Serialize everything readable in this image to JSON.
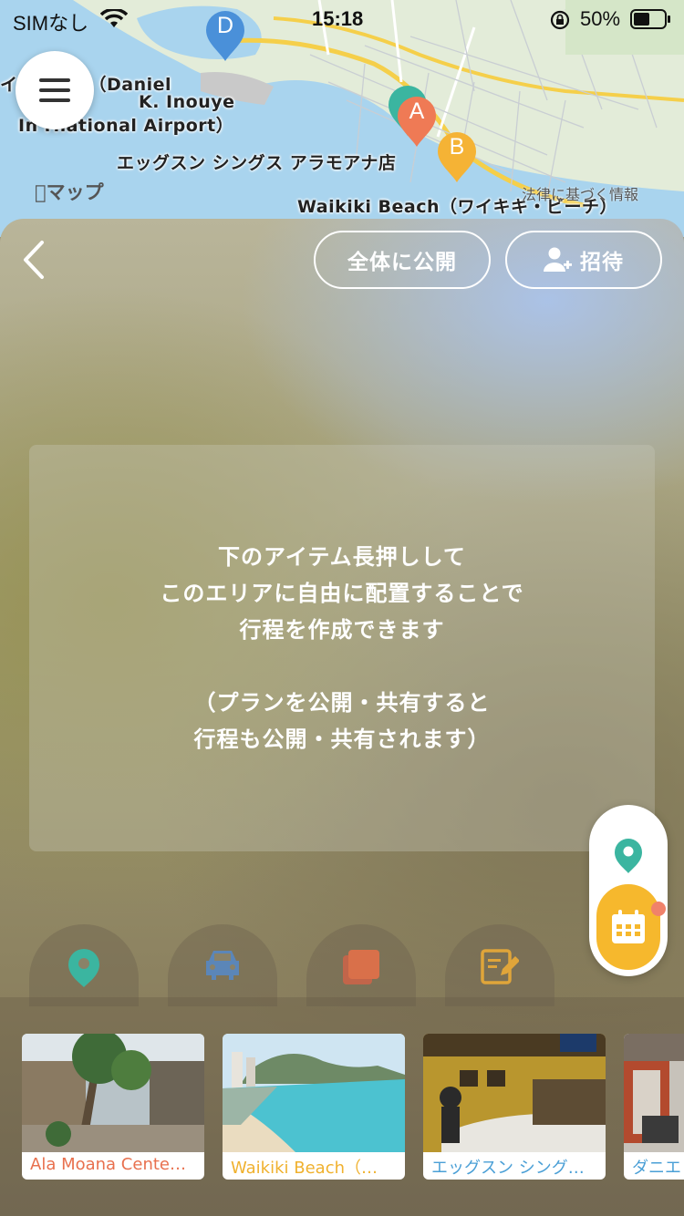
{
  "status_bar": {
    "carrier": "SIMなし",
    "time": "15:18",
    "battery_pct": "50%"
  },
  "map": {
    "labels": {
      "airport_line1": "イ　際空港（Daniel",
      "airport_line2": "K. Inouye",
      "airport_line3": "In  rnational Airport）",
      "eggs": "エッグスン シングス アラモアナ店",
      "waikiki": "Waikiki Beach（ワイキキ・ビーチ）"
    },
    "attribution": "マップ",
    "legal": "法律に基づく情報",
    "pins": [
      {
        "letter": "D",
        "color": "#4a90d9"
      },
      {
        "letter": "A",
        "color": "#ef7a55"
      },
      {
        "letter": "B",
        "color": "#f5b335"
      }
    ]
  },
  "panel": {
    "public_button": "全体に公開",
    "invite_button": "招待",
    "info": {
      "line1": "下のアイテム長押しして",
      "line2": "このエリアに自由に配置することで",
      "line3": "行程を作成できます",
      "line4": "（プランを公開・共有すると",
      "line5": "行程も公開・共有されます）"
    },
    "tabs": [
      {
        "icon": "location-pin-icon",
        "color": "#3bb5a0"
      },
      {
        "icon": "car-icon",
        "color": "#5b86b8"
      },
      {
        "icon": "layers-icon",
        "color": "#d9704a"
      },
      {
        "icon": "memo-edit-icon",
        "color": "#e0a53a"
      }
    ],
    "cards": [
      {
        "label": "Ala Moana Cente…",
        "color": "#e8704e"
      },
      {
        "label": "Waikiki Beach（…",
        "color": "#f0b12e"
      },
      {
        "label": "エッグスン シング…",
        "color": "#4a9fd6"
      },
      {
        "label": "ダニエ",
        "color": "#4a9fd6"
      }
    ]
  }
}
